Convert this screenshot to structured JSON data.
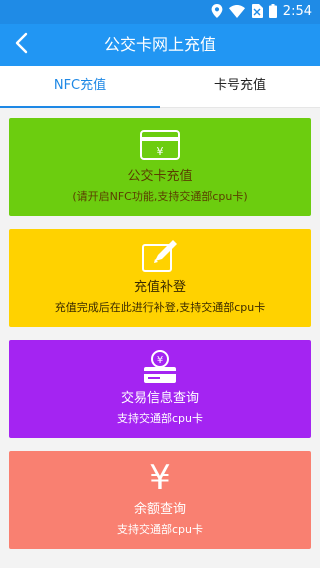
{
  "status_bar": {
    "time": "2:54",
    "icons": [
      "location-icon",
      "wifi-icon",
      "sim-no-signal-icon",
      "battery-icon"
    ]
  },
  "app_bar": {
    "title": "公交卡网上充值",
    "back_icon": "chevron-left-icon"
  },
  "tabs": [
    {
      "label": "NFC充值",
      "active": true
    },
    {
      "label": "卡号充值",
      "active": false
    }
  ],
  "cards": [
    {
      "title": "公交卡充值",
      "subtitle": "(请开启NFC功能,支持交通部cpu卡)",
      "icon": "card-yen-icon",
      "color": "#6ccd0f"
    },
    {
      "title": "充值补登",
      "subtitle": "充值完成后在此进行补登,支持交通部cpu卡",
      "icon": "edit-icon",
      "color": "#ffd200"
    },
    {
      "title": "交易信息查询",
      "subtitle": "支持交通部cpu卡",
      "icon": "coin-card-icon",
      "color": "#a424f2"
    },
    {
      "title": "余额查询",
      "subtitle": "支持交通部cpu卡",
      "icon": "yen-icon",
      "icon_glyph": "¥",
      "color": "#f98071"
    }
  ],
  "colors": {
    "status_bar": "#1f8be6",
    "app_bar": "#2196f3",
    "tab_active": "#1e88e5",
    "background": "#f3f3f3"
  }
}
